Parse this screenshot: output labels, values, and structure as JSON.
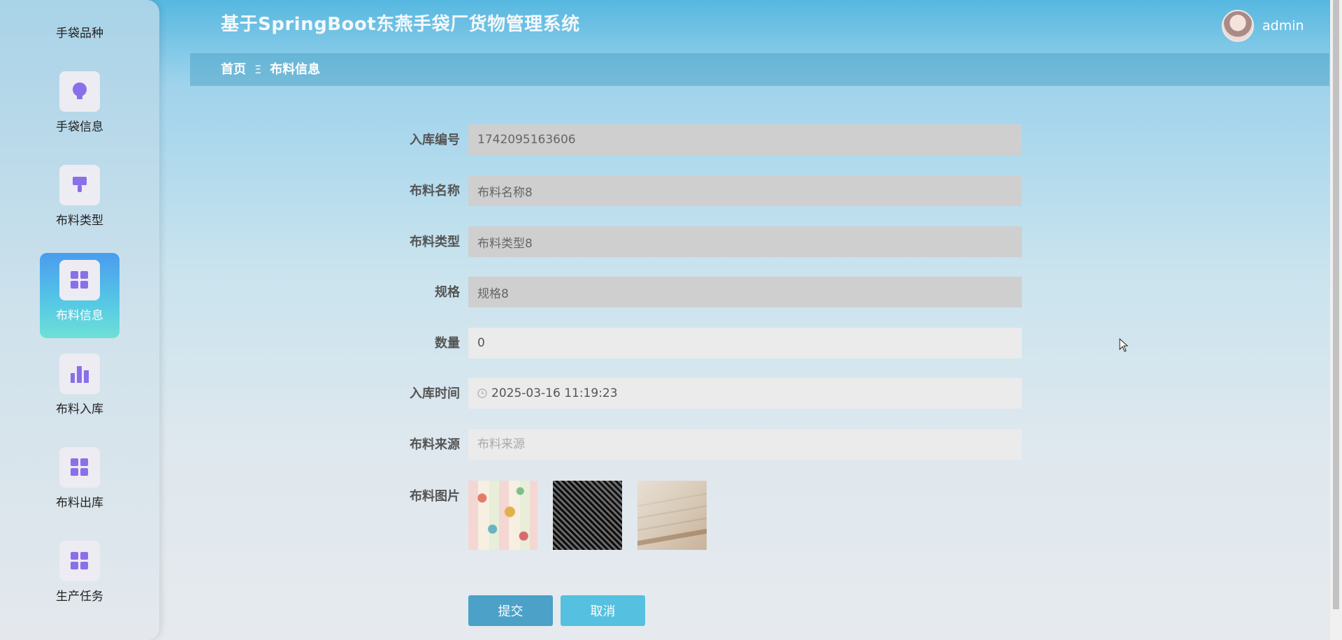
{
  "app": {
    "title": "基于SpringBoot东燕手袋厂货物管理系统",
    "user": "admin"
  },
  "breadcrumb": {
    "home": "首页",
    "separator": "Ξ",
    "current": "布料信息"
  },
  "sidebar": {
    "cut_label": "手袋品种",
    "items": [
      {
        "label": "手袋信息",
        "icon": "lightbulb-icon",
        "active": false
      },
      {
        "label": "布料类型",
        "icon": "brush-icon",
        "active": false
      },
      {
        "label": "布料信息",
        "icon": "grid-icon",
        "active": true
      },
      {
        "label": "布料入库",
        "icon": "bar-chart-icon",
        "active": false
      },
      {
        "label": "布料出库",
        "icon": "grid-icon",
        "active": false
      },
      {
        "label": "生产任务",
        "icon": "grid-icon",
        "active": false
      }
    ]
  },
  "form": {
    "fields": [
      {
        "label": "入库编号",
        "value": "1742095163606",
        "placeholder": "",
        "disabled": true
      },
      {
        "label": "布料名称",
        "value": "布料名称8",
        "placeholder": "",
        "disabled": true
      },
      {
        "label": "布料类型",
        "value": "布料类型8",
        "placeholder": "",
        "disabled": true
      },
      {
        "label": "规格",
        "value": "规格8",
        "placeholder": "",
        "disabled": true
      },
      {
        "label": "数量",
        "value": "0",
        "placeholder": "",
        "disabled": false
      },
      {
        "label": "入库时间",
        "value": "2025-03-16 11:19:23",
        "placeholder": "",
        "disabled": false
      },
      {
        "label": "布料来源",
        "value": "",
        "placeholder": "布料来源",
        "disabled": false
      }
    ],
    "images_label": "布料图片",
    "images": [
      "floral-fabric",
      "houndstooth-fabric",
      "linen-fabric"
    ],
    "submit_label": "提交",
    "cancel_label": "取消"
  },
  "colors": {
    "primary_button": "#4ba1c8",
    "secondary_button": "#55c0df",
    "active_nav": "#4a9cef",
    "icon_purple": "#8b6fe8"
  }
}
